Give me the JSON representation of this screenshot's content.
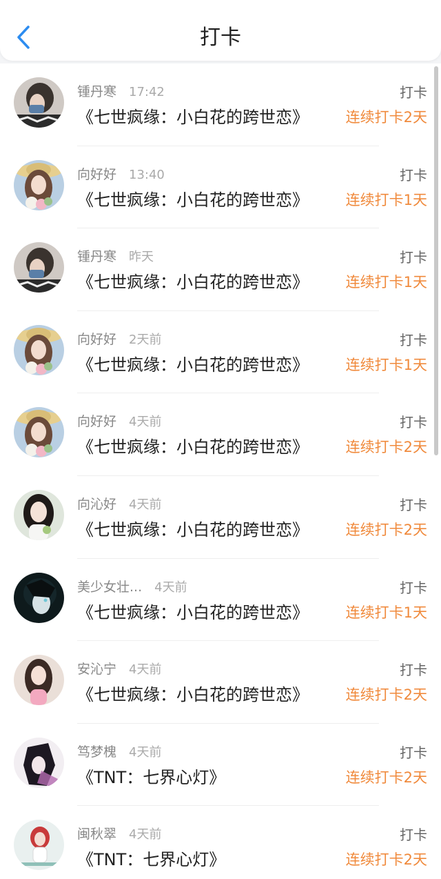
{
  "header": {
    "title": "打卡",
    "back_icon": "chevron-left-icon",
    "accent": "#2c8cf0"
  },
  "colors": {
    "streak": "#f08a3c",
    "name": "#888888",
    "time": "#aaaaaa"
  },
  "entries": [
    {
      "name": "锺丹寒",
      "time": "17:42",
      "book": "《七世疯缘：小白花的跨世恋》",
      "action": "打卡",
      "streak": "连续打卡2天",
      "avatar": "girl-mask-avatar"
    },
    {
      "name": "向好好",
      "time": "13:40",
      "book": "《七世疯缘：小白花的跨世恋》",
      "action": "打卡",
      "streak": "连续打卡1天",
      "avatar": "girl-straw-hat-avatar"
    },
    {
      "name": "锺丹寒",
      "time": "昨天",
      "book": "《七世疯缘：小白花的跨世恋》",
      "action": "打卡",
      "streak": "连续打卡1天",
      "avatar": "girl-mask-avatar"
    },
    {
      "name": "向好好",
      "time": "2天前",
      "book": "《七世疯缘：小白花的跨世恋》",
      "action": "打卡",
      "streak": "连续打卡1天",
      "avatar": "girl-straw-hat-avatar"
    },
    {
      "name": "向好好",
      "time": "4天前",
      "book": "《七世疯缘：小白花的跨世恋》",
      "action": "打卡",
      "streak": "连续打卡2天",
      "avatar": "girl-straw-hat-avatar"
    },
    {
      "name": "向沁好",
      "time": "4天前",
      "book": "《七世疯缘：小白花的跨世恋》",
      "action": "打卡",
      "streak": "连续打卡2天",
      "avatar": "girl-portrait-avatar"
    },
    {
      "name": "美少女壮...",
      "time": "4天前",
      "book": "《七世疯缘：小白花的跨世恋》",
      "action": "打卡",
      "streak": "连续打卡1天",
      "avatar": "anime-boy-avatar"
    },
    {
      "name": "安沁宁",
      "time": "4天前",
      "book": "《七世疯缘：小白花的跨世恋》",
      "action": "打卡",
      "streak": "连续打卡2天",
      "avatar": "girl-pink-avatar"
    },
    {
      "name": "笃梦槐",
      "time": "4天前",
      "book": "《TNT：七界心灯》",
      "action": "打卡",
      "streak": "连续打卡2天",
      "avatar": "anime-dark-avatar"
    },
    {
      "name": "闽秋翠",
      "time": "4天前",
      "book": "《TNT：七界心灯》",
      "action": "打卡",
      "streak": "连续打卡2天",
      "avatar": "girl-red-hair-avatar"
    }
  ]
}
